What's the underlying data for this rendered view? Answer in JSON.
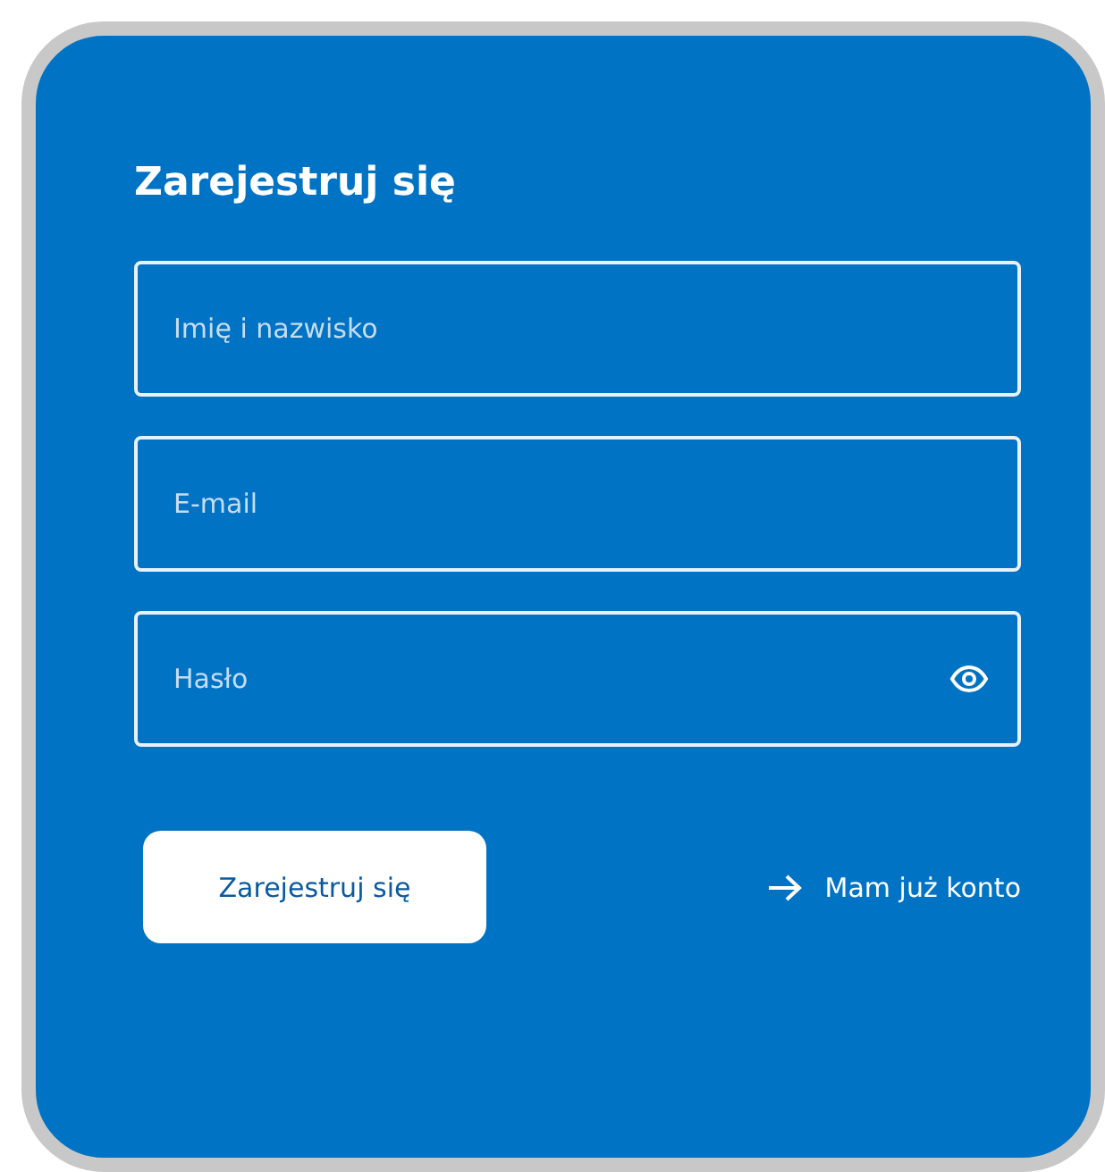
{
  "title": "Zarejestruj się",
  "fields": [
    {
      "placeholder": "Imię i nazwisko",
      "kind": "text"
    },
    {
      "placeholder": "E-mail",
      "kind": "email"
    },
    {
      "placeholder": "Hasło",
      "kind": "password"
    }
  ],
  "submit_button": "Zarejestruj się",
  "login_link": "Mam już konto"
}
